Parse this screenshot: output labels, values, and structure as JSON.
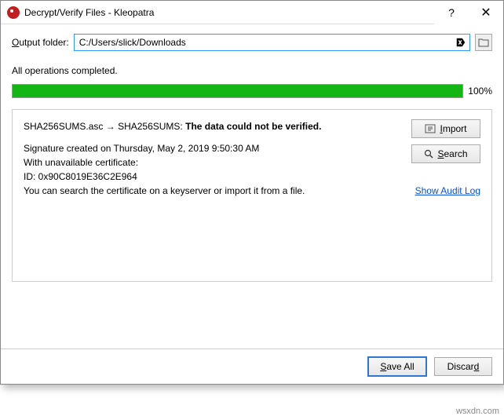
{
  "window": {
    "title": "Decrypt/Verify Files - Kleopatra",
    "help_label": "?",
    "close_label": "✕"
  },
  "output": {
    "label_pre": "O",
    "label_mid": "utput folder:",
    "path": "C:/Users/slick/Downloads"
  },
  "status": {
    "text": "All operations completed.",
    "progress_pct": "100%"
  },
  "result": {
    "file_from": "SHA256SUMS.asc",
    "arrow": "→",
    "file_to": "SHA256SUMS:",
    "verdict": "The data could not be verified.",
    "sig_line": "Signature created on Thursday, May 2, 2019 9:50:30 AM",
    "cert_line": "With unavailable certificate:",
    "id_line": "ID: 0x90C8019E36C2E964",
    "hint_line": "You can search the certificate on a keyserver or import it from a file."
  },
  "buttons": {
    "import_pre": "I",
    "import_rest": "mport",
    "search_pre": "S",
    "search_rest": "earch",
    "audit_log": "Show Audit Log",
    "save_all_pre": "S",
    "save_all_rest": "ave All",
    "discard_pre": "Discar",
    "discard_rest": "d"
  },
  "watermark": "wsxdn.com"
}
